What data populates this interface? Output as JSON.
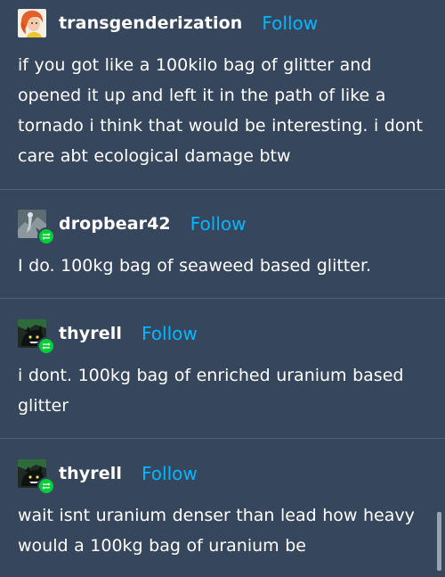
{
  "posts": [
    {
      "username": "transgenderization",
      "follow_label": "Follow",
      "avatar_icon": "avatar-orange-hair",
      "reblog": false,
      "text": "if you got like a 100kilo bag of glitter and opened it up and left it in the path of like a tornado i think that would be interesting. i dont care abt ecological damage btw"
    },
    {
      "username": "dropbear42",
      "follow_label": "Follow",
      "avatar_icon": "avatar-grey-figure",
      "reblog": true,
      "text": "I do. 100kg bag of seaweed based glitter."
    },
    {
      "username": "thyrell",
      "follow_label": "Follow",
      "avatar_icon": "avatar-dark-creature",
      "reblog": true,
      "text": "i dont. 100kg bag of enriched uranium based glitter"
    },
    {
      "username": "thyrell",
      "follow_label": "Follow",
      "avatar_icon": "avatar-dark-creature",
      "reblog": true,
      "text": "wait isnt uranium denser than lead how heavy would a 100kg bag of uranium be"
    }
  ],
  "colors": {
    "background": "#36465d",
    "follow": "#00b8ff",
    "reblog_badge": "#00cf35",
    "divider": "#4f5f74"
  }
}
